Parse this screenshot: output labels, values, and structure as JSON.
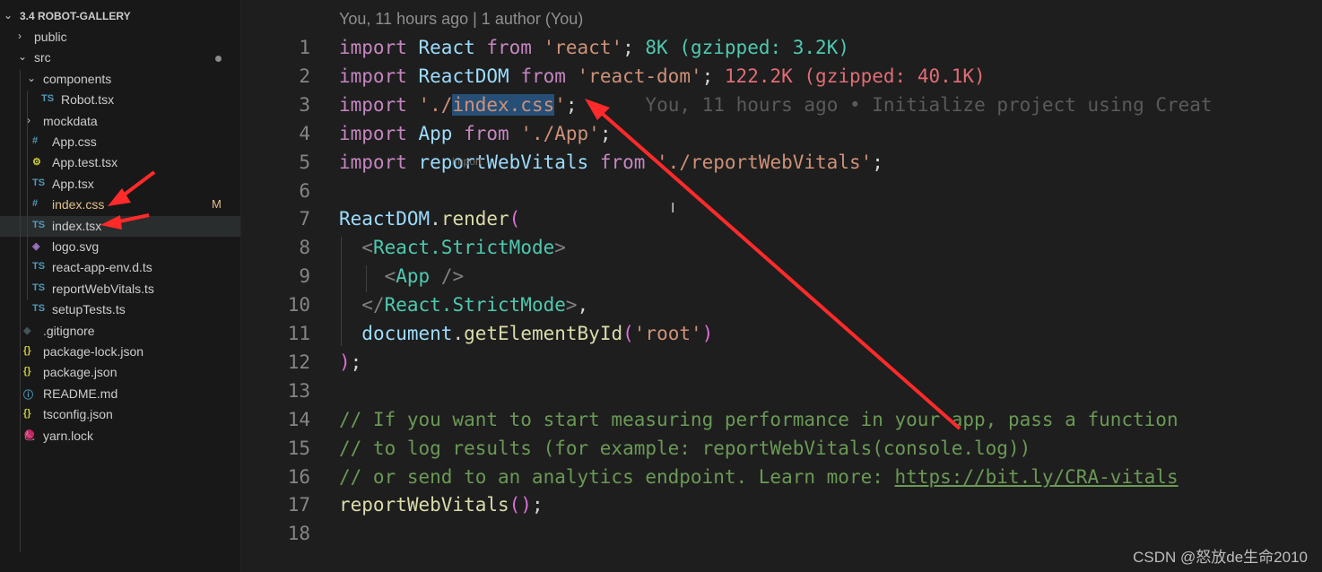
{
  "explorer": {
    "project_title": "3.4 ROBOT-GALLERY",
    "items": [
      {
        "label": "public",
        "kind": "folder",
        "expanded": false,
        "icon": "",
        "icon_color": "",
        "label_color": "#cccccc",
        "badge": ""
      },
      {
        "label": "src",
        "kind": "folder",
        "expanded": true,
        "icon": "",
        "icon_color": "",
        "label_color": "#cccccc",
        "badge": "dot"
      },
      {
        "label": "components",
        "kind": "folder",
        "expanded": true,
        "icon": "",
        "icon_color": "",
        "label_color": "#cccccc",
        "badge": ""
      },
      {
        "label": "Robot.tsx",
        "kind": "file",
        "icon": "TS",
        "icon_color": "#519aba",
        "label_color": "#cccccc",
        "badge": ""
      },
      {
        "label": "mockdata",
        "kind": "folder",
        "expanded": false,
        "icon": "",
        "icon_color": "",
        "label_color": "#cccccc",
        "badge": ""
      },
      {
        "label": "App.css",
        "kind": "file",
        "icon": "#",
        "icon_color": "#519aba",
        "label_color": "#cccccc",
        "badge": ""
      },
      {
        "label": "App.test.tsx",
        "kind": "file",
        "icon": "⚙",
        "icon_color": "#cbcb41",
        "label_color": "#cccccc",
        "badge": ""
      },
      {
        "label": "App.tsx",
        "kind": "file",
        "icon": "TS",
        "icon_color": "#519aba",
        "label_color": "#cccccc",
        "badge": ""
      },
      {
        "label": "index.css",
        "kind": "file",
        "icon": "#",
        "icon_color": "#519aba",
        "label_color": "#e2c08d",
        "badge": "M"
      },
      {
        "label": "index.tsx",
        "kind": "file",
        "icon": "TS",
        "icon_color": "#519aba",
        "label_color": "#cccccc",
        "badge": ""
      },
      {
        "label": "logo.svg",
        "kind": "file",
        "icon": "◈",
        "icon_color": "#a074c4",
        "label_color": "#cccccc",
        "badge": ""
      },
      {
        "label": "react-app-env.d.ts",
        "kind": "file",
        "icon": "TS",
        "icon_color": "#519aba",
        "label_color": "#cccccc",
        "badge": ""
      },
      {
        "label": "reportWebVitals.ts",
        "kind": "file",
        "icon": "TS",
        "icon_color": "#519aba",
        "label_color": "#cccccc",
        "badge": ""
      },
      {
        "label": "setupTests.ts",
        "kind": "file",
        "icon": "TS",
        "icon_color": "#519aba",
        "label_color": "#cccccc",
        "badge": ""
      },
      {
        "label": ".gitignore",
        "kind": "file",
        "icon": "◆",
        "icon_color": "#41535b",
        "label_color": "#cccccc",
        "badge": ""
      },
      {
        "label": "package-lock.json",
        "kind": "file",
        "icon": "{}",
        "icon_color": "#cbcb41",
        "label_color": "#cccccc",
        "badge": ""
      },
      {
        "label": "package.json",
        "kind": "file",
        "icon": "{}",
        "icon_color": "#cbcb41",
        "label_color": "#cccccc",
        "badge": ""
      },
      {
        "label": "README.md",
        "kind": "file",
        "icon": "ⓘ",
        "icon_color": "#519aba",
        "label_color": "#cccccc",
        "badge": ""
      },
      {
        "label": "tsconfig.json",
        "kind": "file",
        "icon": "{}",
        "icon_color": "#cbcb41",
        "label_color": "#cccccc",
        "badge": ""
      },
      {
        "label": "yarn.lock",
        "kind": "file",
        "icon": "🧶",
        "icon_color": "#519aba",
        "label_color": "#cccccc",
        "badge": ""
      }
    ]
  },
  "editor": {
    "blame_header": "You, 11 hours ago | 1 author (You)",
    "inline_hint": "You, 11 hours ago • Initialize project using Creat",
    "import_hint": "import",
    "line_numbers": [
      "1",
      "2",
      "3",
      "4",
      "5",
      "6",
      "7",
      "8",
      "9",
      "10",
      "11",
      "12",
      "13",
      "14",
      "15",
      "16",
      "17",
      "18"
    ],
    "lines": [
      [
        {
          "t": "import ",
          "c": "kw"
        },
        {
          "t": "React ",
          "c": "id"
        },
        {
          "t": "from ",
          "c": "kw"
        },
        {
          "t": "'react'",
          "c": "str"
        },
        {
          "t": "; ",
          "c": ""
        },
        {
          "t": "8K (gzipped: 3.2K)",
          "c": "size"
        }
      ],
      [
        {
          "t": "import ",
          "c": "kw"
        },
        {
          "t": "ReactDOM ",
          "c": "id"
        },
        {
          "t": "from ",
          "c": "kw"
        },
        {
          "t": "'react-dom'",
          "c": "str"
        },
        {
          "t": "; ",
          "c": ""
        },
        {
          "t": "122.2K (gzipped: 40.1K)",
          "c": "size-red"
        }
      ],
      [
        {
          "t": "import ",
          "c": "kw"
        },
        {
          "t": "'./",
          "c": "str"
        },
        {
          "t": "index.css",
          "c": "str sel"
        },
        {
          "t": "'",
          "c": "str"
        },
        {
          "t": ";",
          "c": ""
        }
      ],
      [
        {
          "t": "import ",
          "c": "kw"
        },
        {
          "t": "App ",
          "c": "id"
        },
        {
          "t": "from ",
          "c": "kw"
        },
        {
          "t": "'./App'",
          "c": "str"
        },
        {
          "t": ";",
          "c": ""
        }
      ],
      [
        {
          "t": "import ",
          "c": "kw"
        },
        {
          "t": "reportWebVitals ",
          "c": "id"
        },
        {
          "t": "from ",
          "c": "kw"
        },
        {
          "t": "'./reportWebVitals'",
          "c": "str"
        },
        {
          "t": ";",
          "c": ""
        }
      ],
      [],
      [
        {
          "t": "ReactDOM",
          "c": "id"
        },
        {
          "t": ".",
          "c": ""
        },
        {
          "t": "render",
          "c": "fn"
        },
        {
          "t": "(",
          "c": "paren"
        }
      ],
      [
        {
          "t": "  ",
          "c": ""
        },
        {
          "t": "<",
          "c": "brk"
        },
        {
          "t": "React.StrictMode",
          "c": "tag"
        },
        {
          "t": ">",
          "c": "brk"
        }
      ],
      [
        {
          "t": "    ",
          "c": ""
        },
        {
          "t": "<",
          "c": "brk"
        },
        {
          "t": "App ",
          "c": "tag"
        },
        {
          "t": "/>",
          "c": "brk"
        }
      ],
      [
        {
          "t": "  ",
          "c": ""
        },
        {
          "t": "</",
          "c": "brk"
        },
        {
          "t": "React.StrictMode",
          "c": "tag"
        },
        {
          "t": ">",
          "c": "brk"
        },
        {
          "t": ",",
          "c": ""
        }
      ],
      [
        {
          "t": "  ",
          "c": ""
        },
        {
          "t": "document",
          "c": "id"
        },
        {
          "t": ".",
          "c": ""
        },
        {
          "t": "getElementById",
          "c": "fn"
        },
        {
          "t": "(",
          "c": "paren"
        },
        {
          "t": "'root'",
          "c": "str"
        },
        {
          "t": ")",
          "c": "paren"
        }
      ],
      [
        {
          "t": ")",
          "c": "paren"
        },
        {
          "t": ";",
          "c": ""
        }
      ],
      [],
      [
        {
          "t": "// If you want to start measuring performance in your app, pass a function",
          "c": "cm"
        }
      ],
      [
        {
          "t": "// to log results (for example: reportWebVitals(console.log))",
          "c": "cm"
        }
      ],
      [
        {
          "t": "// or send to an analytics endpoint. Learn more: ",
          "c": "cm"
        },
        {
          "t": "https://bit.ly/CRA-vitals",
          "c": "cm url"
        }
      ],
      [
        {
          "t": "reportWebVitals",
          "c": "fn"
        },
        {
          "t": "()",
          "c": "paren"
        },
        {
          "t": ";",
          "c": ""
        }
      ],
      []
    ]
  },
  "annotation": {
    "arrow_color": "#ff2a2a"
  },
  "watermark": "CSDN @怒放de生命2010"
}
